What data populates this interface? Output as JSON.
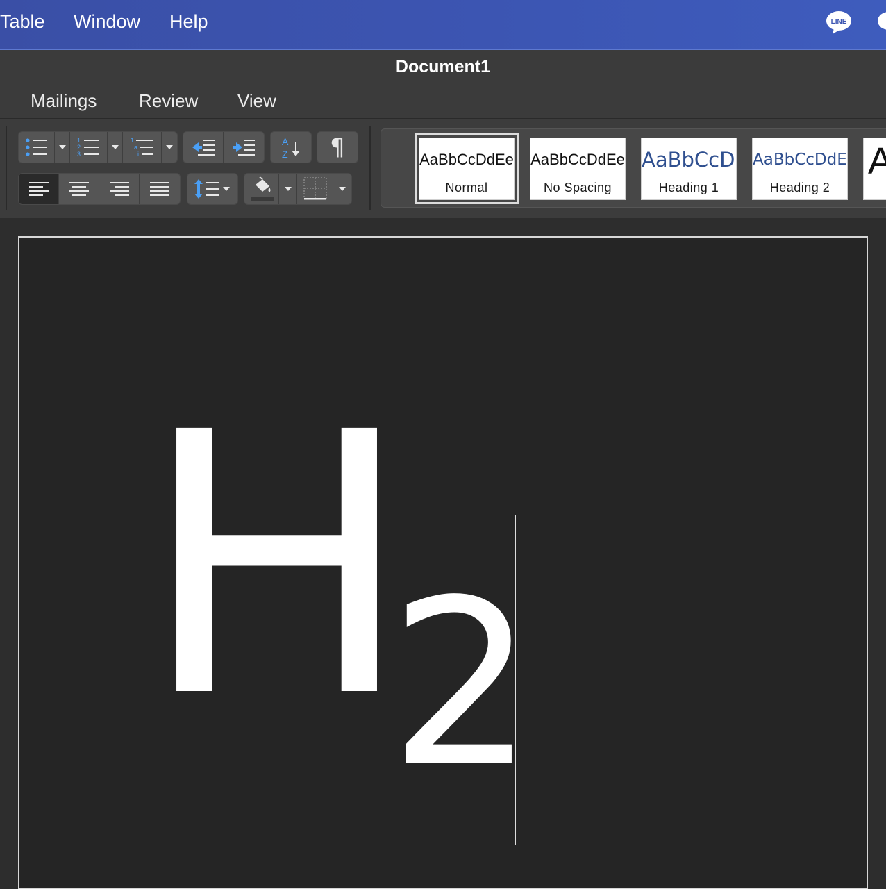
{
  "menubar": {
    "items": [
      "Table",
      "Window",
      "Help"
    ],
    "tray": {
      "line_icon": "LINE",
      "chat_icon": "speech-bubble-icon"
    }
  },
  "window": {
    "title": "Document1"
  },
  "ribbon": {
    "tabs": [
      "Mailings",
      "Review",
      "View"
    ],
    "paragraph_icons": [
      "bullets-icon",
      "numbering-icon",
      "multilevel-list-icon",
      "decrease-indent-icon",
      "increase-indent-icon",
      "sort-icon",
      "pilcrow-icon",
      "align-left-icon",
      "align-center-icon",
      "align-right-icon",
      "justify-icon",
      "line-spacing-icon",
      "shading-icon",
      "borders-icon"
    ],
    "sort_glyphs": {
      "a": "A",
      "z": "Z"
    },
    "pilcrow": "¶",
    "styles": [
      {
        "sample": "AaBbCcDdEe",
        "name": "Normal"
      },
      {
        "sample": "AaBbCcDdEe",
        "name": "No Spacing"
      },
      {
        "sample": "AaBbCcDc",
        "name": "Heading 1"
      },
      {
        "sample": "AaBbCcDdEe",
        "name": "Heading 2"
      },
      {
        "sample": "A",
        "name": ""
      }
    ]
  },
  "document": {
    "text_main": "H",
    "text_subscript": "2"
  },
  "colors": {
    "menubar": "#3c55b2",
    "heading_blue": "#2f4f8f",
    "page_bg": "#252525"
  }
}
